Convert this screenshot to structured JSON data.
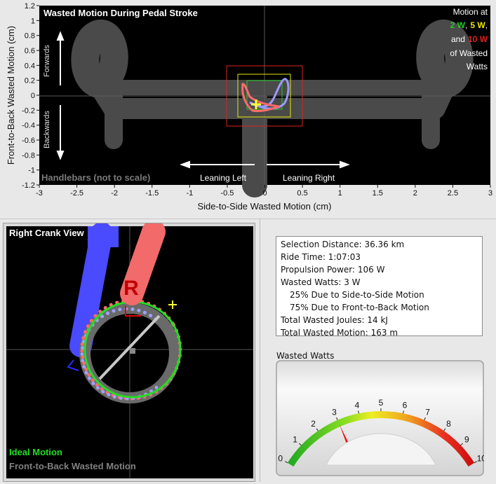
{
  "top_plot": {
    "title": "Wasted Motion During Pedal Stroke",
    "ylabel": "Front-to-Back Wasted Motion (cm)",
    "xlabel": "Side-to-Side Wasted Motion (cm)",
    "xlim": [
      -3,
      3
    ],
    "ylim": [
      -1.2,
      1.2
    ],
    "x_ticks": [
      "-3",
      "-2.5",
      "-2",
      "-1.5",
      "-1",
      "-0.5",
      "0",
      "0.5",
      "1",
      "1.5",
      "2",
      "2.5",
      "3"
    ],
    "y_ticks": [
      "1.2",
      "1",
      "0.8",
      "0.6",
      "0.4",
      "0.2",
      "0",
      "-0.2",
      "-0.4",
      "-0.6",
      "-0.8",
      "-1",
      "-1.2"
    ],
    "forwards": "Forwards",
    "backwards": "Backwards",
    "leaning_left": "Leaning Left",
    "leaning_right": "Leaning Right",
    "handlebars_note": "Handlebars (not to scale)",
    "legend": {
      "line1": "Motion at",
      "w2": "2 W",
      "comma1": ",",
      "w5": "5 W",
      "comma2": ",",
      "and": "and",
      "w10": "10 W",
      "line3": "of Wasted",
      "line4": "Watts"
    },
    "colors": {
      "bg": "#000000",
      "handlebar": "#4a4a4a",
      "w2": "#22cc22",
      "w5": "#e8e800",
      "w10": "#dd2222",
      "pink": "#ff6a6a",
      "lavender": "#9a9aff",
      "marker": "#ffff33"
    }
  },
  "crank": {
    "title": "Right Crank View",
    "crank_letter": "R",
    "ideal_label": "Ideal Motion",
    "wasted_label": "Front-to-Back Wasted Motion",
    "colors": {
      "ideal": "#22dd22",
      "wasted_text": "#808080",
      "crank": "#f26a6a",
      "left_crank": "#4a4aff"
    }
  },
  "stats": {
    "selection_distance": "Selection Distance: 36.36 km",
    "ride_time": "Ride Time: 1:07:03",
    "propulsion_power": "Propulsion Power: 106 W",
    "wasted_watts": "Wasted Watts: 3 W",
    "side_pct": "25% Due to Side-to-Side Motion",
    "front_pct": "75% Due to Front-to-Back Motion",
    "joules": "Total Wasted Joules: 14 kJ",
    "motion": "Total Wasted Motion: 163 m"
  },
  "gauge": {
    "label": "Wasted Watts",
    "ticks": [
      "0",
      "1",
      "2",
      "3",
      "4",
      "5",
      "6",
      "7",
      "8",
      "9",
      "10"
    ],
    "min": 0,
    "max": 10,
    "value": 3
  }
}
